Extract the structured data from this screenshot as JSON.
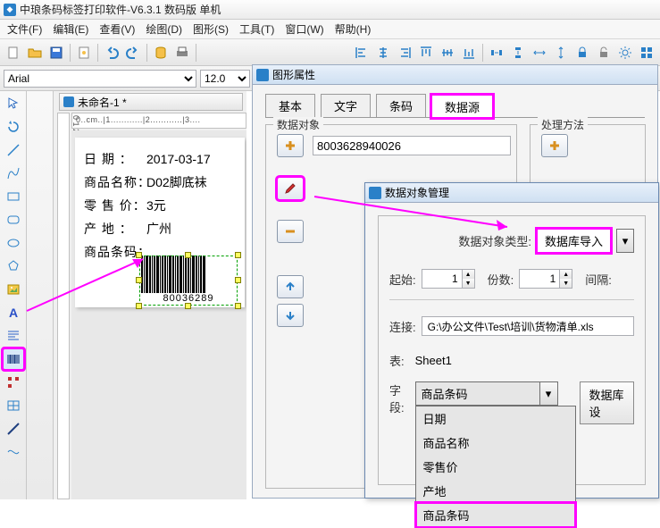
{
  "window": {
    "title": "中琅条码标签打印软件-V6.3.1 数码版 单机"
  },
  "menu": [
    "文件(F)",
    "编辑(E)",
    "查看(V)",
    "绘图(D)",
    "图形(S)",
    "工具(T)",
    "窗口(W)",
    "帮助(H)"
  ],
  "font": {
    "name": "Arial",
    "size": "12.0"
  },
  "doc": {
    "title": "未命名-1 *"
  },
  "label": {
    "date_lab": "日 期 ：",
    "date_val": "2017-03-17",
    "name_lab": "商品名称：",
    "name_val": "D02脚底袜",
    "price_lab": "零 售 价：",
    "price_val": "3元",
    "origin_lab": "产 地 ：",
    "origin_val": "广州",
    "barcode_lab": "商品条码：",
    "barcode_num": "80036289"
  },
  "prop_panel": {
    "title": "图形属性",
    "tabs": {
      "basic": "基本",
      "text": "文字",
      "barcode": "条码",
      "datasource": "数据源"
    },
    "data_object_legend": "数据对象",
    "process_legend": "处理方法",
    "data_value": "8003628940026"
  },
  "dialog": {
    "title": "数据对象管理",
    "type_label": "数据对象类型:",
    "type_value": "数据库导入",
    "start_label": "起始:",
    "start_value": "1",
    "copies_label": "份数:",
    "copies_value": "1",
    "interval_label": "间隔:",
    "conn_label": "连接:",
    "conn_value": "G:\\办公文件\\Test\\培训\\货物清单.xls",
    "table_label": "表:",
    "table_value": "Sheet1",
    "field_label": "字段:",
    "field_value": "商品条码",
    "field_options": [
      "日期",
      "商品名称",
      "零售价",
      "产地",
      "商品条码"
    ],
    "test_btn": "数据库设"
  }
}
